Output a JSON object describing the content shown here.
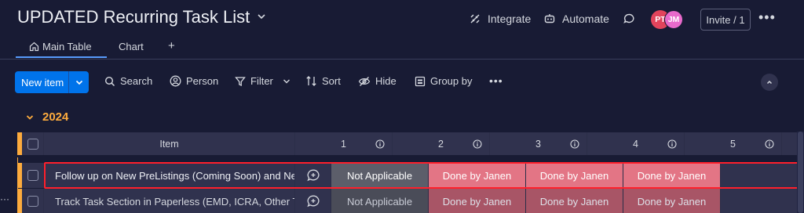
{
  "header": {
    "board_title": "UPDATED Recurring Task List",
    "integrate_label": "Integrate",
    "automate_label": "Automate",
    "avatars": [
      {
        "initials": "PT",
        "color": "#e2445c"
      },
      {
        "initials": "JM",
        "color": "#e86acb"
      }
    ],
    "invite_label": "Invite / 1"
  },
  "tabs": [
    {
      "label": "Main Table",
      "icon": "home-icon",
      "active": true
    },
    {
      "label": "Chart",
      "active": false
    },
    {
      "label": "+",
      "active": false
    }
  ],
  "toolbar": {
    "new_item_label": "New item",
    "search_label": "Search",
    "person_label": "Person",
    "filter_label": "Filter",
    "sort_label": "Sort",
    "hide_label": "Hide",
    "group_by_label": "Group by"
  },
  "group": {
    "title": "2024",
    "color": "#fdab3d"
  },
  "table": {
    "item_header": "Item",
    "status_headers": [
      "1",
      "2",
      "3",
      "4",
      "5"
    ],
    "rows": [
      {
        "item": "Follow up on New PreListings (Coming Soon) and New Active ...",
        "statuses": [
          "",
          "Not Applicable",
          "Done by Janen",
          "Done by Janen",
          "Done by Janen"
        ]
      },
      {
        "item": "Track Task Section in Paperless (EMD, ICRA, Other Tasks)",
        "statuses": [
          "",
          "Not Applicable",
          "Done by Janen",
          "Done by Janen",
          "Done by Janen"
        ]
      }
    ]
  },
  "colors": {
    "background": "#181b34",
    "accent": "#0073ea",
    "not_applicable": "#5c5e6a",
    "done_by_janen": "#e2445c",
    "highlight": "#ff1f2b"
  }
}
